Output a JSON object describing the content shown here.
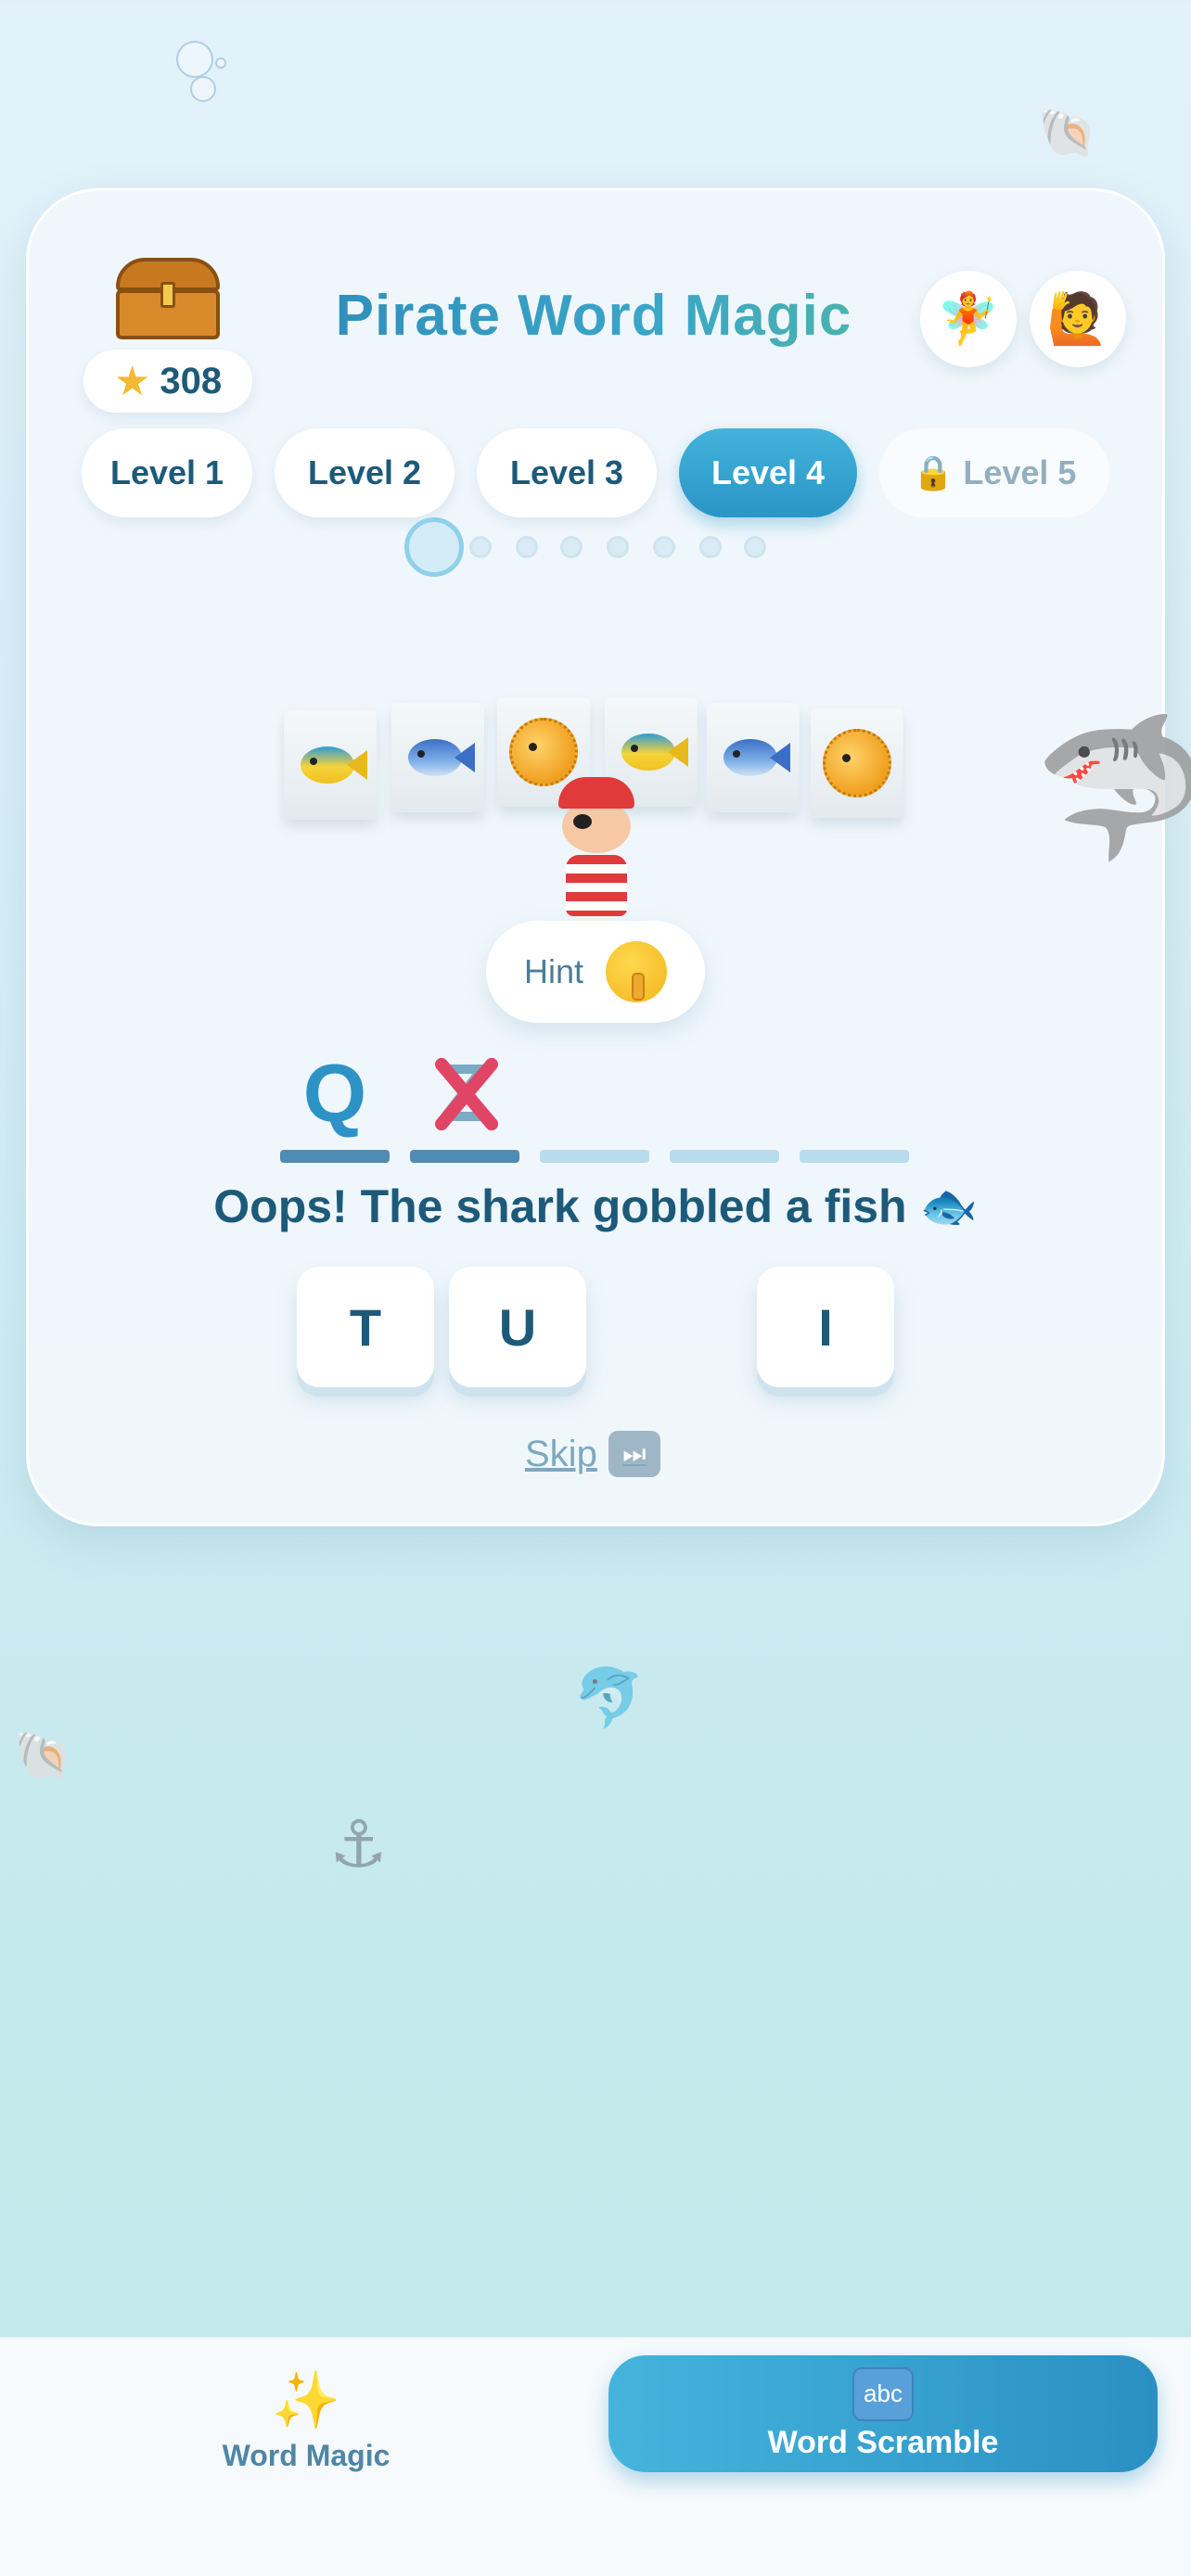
{
  "app": {
    "title": "Pirate Word Magic",
    "score": "308",
    "helper_icons": [
      "fairy-icon",
      "raised-hand-person-icon"
    ]
  },
  "levels": [
    {
      "label": "Level 1",
      "state": "unlocked"
    },
    {
      "label": "Level 2",
      "state": "unlocked"
    },
    {
      "label": "Level 3",
      "state": "unlocked"
    },
    {
      "label": "Level 4",
      "state": "active"
    },
    {
      "label": "Level 5",
      "state": "locked"
    }
  ],
  "progress": {
    "current": 1,
    "total": 8
  },
  "puzzle": {
    "picture_tiles": [
      "tropical-fish-icon",
      "fish-icon",
      "blowfish-icon",
      "tropical-fish-icon",
      "fish-icon",
      "blowfish-icon"
    ],
    "hint_label": "Hint",
    "slots": [
      "Q",
      "Z",
      "",
      "",
      ""
    ],
    "slot_states": [
      "correct",
      "wrong",
      "empty",
      "empty",
      "empty"
    ],
    "message": "Oops! The shark gobbled a fish 🐟",
    "letters": [
      "T",
      "U",
      "",
      "I"
    ],
    "skip_label": "Skip"
  },
  "nav": {
    "word_magic": "Word Magic",
    "word_scramble": "Word Scramble",
    "word_scramble_icon_text": "abc",
    "active": "word_scramble"
  },
  "colors": {
    "accent": "#2a95c6",
    "text": "#1d5a7a",
    "error": "#e14565"
  }
}
